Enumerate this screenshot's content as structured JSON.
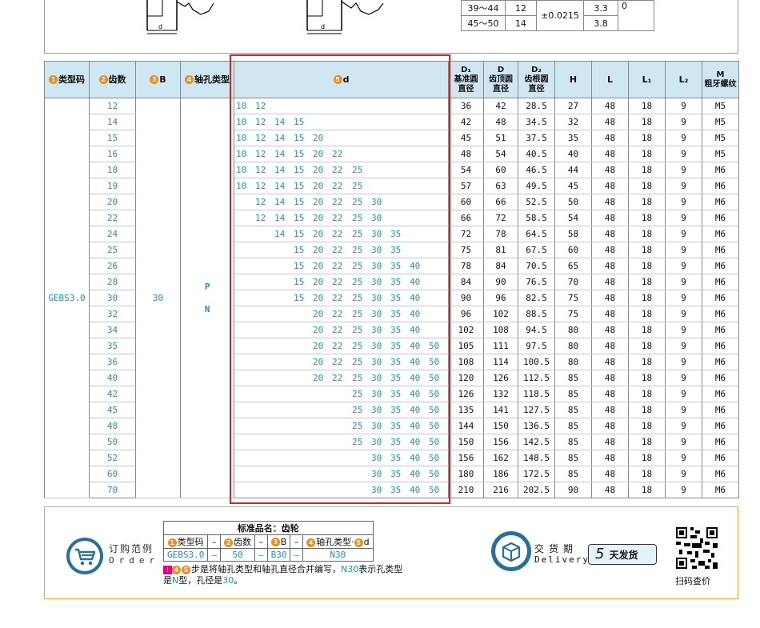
{
  "top": {
    "drawing_labels": [
      "d",
      "d"
    ],
    "table_rows": [
      {
        "range": "39～44",
        "v1": "12",
        "v3": "3.3"
      },
      {
        "range": "45～50",
        "v1": "14",
        "v3": "3.8"
      }
    ],
    "tolerance": "±0.0215",
    "right_value": "0"
  },
  "headers": {
    "type_code": {
      "num": "1",
      "label": "类型码"
    },
    "teeth": {
      "num": "2",
      "label": "齿数"
    },
    "b": {
      "num": "3",
      "label": "B"
    },
    "bore_type": {
      "num": "4",
      "label": "轴孔类型"
    },
    "d": {
      "num": "5",
      "label": "d"
    },
    "d1": {
      "symbol": "D₁",
      "lines": [
        "基准圆",
        "直径"
      ]
    },
    "dd": {
      "symbol": "D",
      "lines": [
        "齿顶圆",
        "直径"
      ]
    },
    "d2": {
      "symbol": "D₂",
      "lines": [
        "齿根圆",
        "直径"
      ]
    },
    "h": "H",
    "l": "L",
    "l1": "L₁",
    "l2": "L₂",
    "m": {
      "symbol": "M",
      "lines": [
        "粗牙螺纹"
      ]
    }
  },
  "merged": {
    "type_code": "GEBS3.0",
    "b": "30",
    "bore_type_1": "P",
    "bore_type_2": "N"
  },
  "rows": [
    {
      "teeth": "12",
      "d": [
        "10",
        "12"
      ],
      "D1": "36",
      "D": "42",
      "D2": "28.5",
      "H": "27",
      "L": "48",
      "L1": "18",
      "L2": "9",
      "M": "M5"
    },
    {
      "teeth": "14",
      "d": [
        "10",
        "12",
        "14",
        "15"
      ],
      "D1": "42",
      "D": "48",
      "D2": "34.5",
      "H": "32",
      "L": "48",
      "L1": "18",
      "L2": "9",
      "M": "M5"
    },
    {
      "teeth": "15",
      "d": [
        "10",
        "12",
        "14",
        "15",
        "20"
      ],
      "D1": "45",
      "D": "51",
      "D2": "37.5",
      "H": "35",
      "L": "48",
      "L1": "18",
      "L2": "9",
      "M": "M5"
    },
    {
      "teeth": "16",
      "d": [
        "10",
        "12",
        "14",
        "15",
        "20",
        "22"
      ],
      "D1": "48",
      "D": "54",
      "D2": "40.5",
      "H": "40",
      "L": "48",
      "L1": "18",
      "L2": "9",
      "M": "M5"
    },
    {
      "teeth": "18",
      "d": [
        "10",
        "12",
        "14",
        "15",
        "20",
        "22",
        "25"
      ],
      "D1": "54",
      "D": "60",
      "D2": "46.5",
      "H": "44",
      "L": "48",
      "L1": "18",
      "L2": "9",
      "M": "M6"
    },
    {
      "teeth": "19",
      "d": [
        "10",
        "12",
        "14",
        "15",
        "20",
        "22",
        "25"
      ],
      "D1": "57",
      "D": "63",
      "D2": "49.5",
      "H": "45",
      "L": "48",
      "L1": "18",
      "L2": "9",
      "M": "M6"
    },
    {
      "teeth": "20",
      "d": [
        "12",
        "14",
        "15",
        "20",
        "22",
        "25",
        "30"
      ],
      "D1": "60",
      "D": "66",
      "D2": "52.5",
      "H": "50",
      "L": "48",
      "L1": "18",
      "L2": "9",
      "M": "M6"
    },
    {
      "teeth": "22",
      "d": [
        "12",
        "14",
        "15",
        "20",
        "22",
        "25",
        "30"
      ],
      "D1": "66",
      "D": "72",
      "D2": "58.5",
      "H": "54",
      "L": "48",
      "L1": "18",
      "L2": "9",
      "M": "M6"
    },
    {
      "teeth": "24",
      "d": [
        "14",
        "15",
        "20",
        "22",
        "25",
        "30",
        "35"
      ],
      "D1": "72",
      "D": "78",
      "D2": "64.5",
      "H": "58",
      "L": "48",
      "L1": "18",
      "L2": "9",
      "M": "M6"
    },
    {
      "teeth": "25",
      "d": [
        "15",
        "20",
        "22",
        "25",
        "30",
        "35"
      ],
      "D1": "75",
      "D": "81",
      "D2": "67.5",
      "H": "60",
      "L": "48",
      "L1": "18",
      "L2": "9",
      "M": "M6"
    },
    {
      "teeth": "26",
      "d": [
        "15",
        "20",
        "22",
        "25",
        "30",
        "35",
        "40"
      ],
      "D1": "78",
      "D": "84",
      "D2": "70.5",
      "H": "65",
      "L": "48",
      "L1": "18",
      "L2": "9",
      "M": "M6"
    },
    {
      "teeth": "28",
      "d": [
        "15",
        "20",
        "22",
        "25",
        "30",
        "35",
        "40"
      ],
      "D1": "84",
      "D": "90",
      "D2": "76.5",
      "H": "70",
      "L": "48",
      "L1": "18",
      "L2": "9",
      "M": "M6"
    },
    {
      "teeth": "30",
      "d": [
        "15",
        "20",
        "22",
        "25",
        "30",
        "35",
        "40"
      ],
      "D1": "90",
      "D": "96",
      "D2": "82.5",
      "H": "75",
      "L": "48",
      "L1": "18",
      "L2": "9",
      "M": "M6"
    },
    {
      "teeth": "32",
      "d": [
        "20",
        "22",
        "25",
        "30",
        "35",
        "40"
      ],
      "D1": "96",
      "D": "102",
      "D2": "88.5",
      "H": "75",
      "L": "48",
      "L1": "18",
      "L2": "9",
      "M": "M6"
    },
    {
      "teeth": "34",
      "d": [
        "20",
        "22",
        "25",
        "30",
        "35",
        "40"
      ],
      "D1": "102",
      "D": "108",
      "D2": "94.5",
      "H": "80",
      "L": "48",
      "L1": "18",
      "L2": "9",
      "M": "M6"
    },
    {
      "teeth": "35",
      "d": [
        "20",
        "22",
        "25",
        "30",
        "35",
        "40",
        "50"
      ],
      "D1": "105",
      "D": "111",
      "D2": "97.5",
      "H": "80",
      "L": "48",
      "L1": "18",
      "L2": "9",
      "M": "M6"
    },
    {
      "teeth": "36",
      "d": [
        "20",
        "22",
        "25",
        "30",
        "35",
        "40",
        "50"
      ],
      "D1": "108",
      "D": "114",
      "D2": "100.5",
      "H": "80",
      "L": "48",
      "L1": "18",
      "L2": "9",
      "M": "M6"
    },
    {
      "teeth": "40",
      "d": [
        "20",
        "22",
        "25",
        "30",
        "35",
        "40",
        "50"
      ],
      "D1": "120",
      "D": "126",
      "D2": "112.5",
      "H": "85",
      "L": "48",
      "L1": "18",
      "L2": "9",
      "M": "M6"
    },
    {
      "teeth": "42",
      "d": [
        "25",
        "30",
        "35",
        "40",
        "50"
      ],
      "D1": "126",
      "D": "132",
      "D2": "118.5",
      "H": "85",
      "L": "48",
      "L1": "18",
      "L2": "9",
      "M": "M6"
    },
    {
      "teeth": "45",
      "d": [
        "25",
        "30",
        "35",
        "40",
        "50"
      ],
      "D1": "135",
      "D": "141",
      "D2": "127.5",
      "H": "85",
      "L": "48",
      "L1": "18",
      "L2": "9",
      "M": "M6"
    },
    {
      "teeth": "48",
      "d": [
        "25",
        "30",
        "35",
        "40",
        "50"
      ],
      "D1": "144",
      "D": "150",
      "D2": "136.5",
      "H": "85",
      "L": "48",
      "L1": "18",
      "L2": "9",
      "M": "M6"
    },
    {
      "teeth": "50",
      "d": [
        "25",
        "30",
        "35",
        "40",
        "50"
      ],
      "D1": "150",
      "D": "156",
      "D2": "142.5",
      "H": "85",
      "L": "48",
      "L1": "18",
      "L2": "9",
      "M": "M6"
    },
    {
      "teeth": "52",
      "d": [
        "30",
        "35",
        "40",
        "50"
      ],
      "D1": "156",
      "D": "162",
      "D2": "148.5",
      "H": "85",
      "L": "48",
      "L1": "18",
      "L2": "9",
      "M": "M6"
    },
    {
      "teeth": "60",
      "d": [
        "30",
        "35",
        "40",
        "50"
      ],
      "D1": "180",
      "D": "186",
      "D2": "172.5",
      "H": "85",
      "L": "48",
      "L1": "18",
      "L2": "9",
      "M": "M6"
    },
    {
      "teeth": "70",
      "d": [
        "30",
        "35",
        "40",
        "50"
      ],
      "D1": "210",
      "D": "216",
      "D2": "202.5",
      "H": "90",
      "L": "48",
      "L1": "18",
      "L2": "9",
      "M": "M6"
    }
  ],
  "order": {
    "title": "订购范例",
    "subtitle": "Order",
    "std_name": "标准品名：齿轮",
    "col_labels": [
      "类型码",
      "齿数",
      "B",
      "轴孔类型·"
    ],
    "col_d_label": "d",
    "values": [
      "GEBS3.0",
      "50",
      "B30",
      "N30"
    ],
    "dash": "–",
    "note_a": "步是将轴孔类型和轴孔直径合并编写，",
    "note_b": "N30",
    "note_c": "表示孔类型",
    "note_d": "是",
    "note_e": "N",
    "note_f": "型，孔径是",
    "note_g": "30",
    "note_h": "。"
  },
  "delivery": {
    "title": "交货期",
    "subtitle": "Delivery",
    "days": "5",
    "days_label": "天发货"
  },
  "qr_label": "扫码查价"
}
